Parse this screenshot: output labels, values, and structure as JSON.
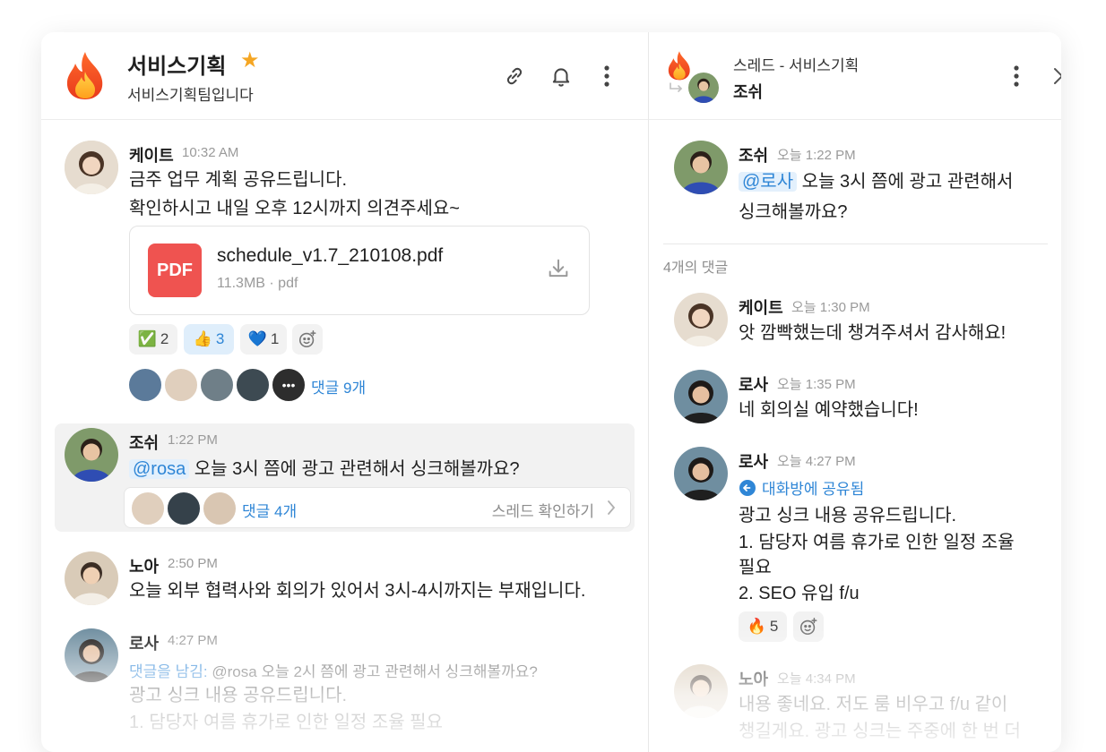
{
  "channel": {
    "title": "서비스기획",
    "subtitle": "서비스기획팀입니다",
    "icons": [
      "fire-emoji",
      "star-icon",
      "link-icon",
      "bell-icon",
      "more-vertical-icon"
    ]
  },
  "messages": [
    {
      "name": "케이트",
      "time": "10:32 AM",
      "lines": [
        "금주 업무 계획 공유드립니다.",
        "확인하시고 내일 오후 12시까지 의견주세요~"
      ],
      "file": {
        "name": "schedule_v1.7_210108.pdf",
        "meta": "11.3MB · pdf",
        "badge": "PDF"
      },
      "reactions": [
        {
          "emoji": "✅",
          "count": "2"
        },
        {
          "emoji": "👍",
          "count": "3"
        },
        {
          "emoji": "💙",
          "count": "1"
        }
      ],
      "replies": "댓글 9개"
    },
    {
      "name": "조쉬",
      "time": "1:22 PM",
      "mention": "@rosa",
      "text": "오늘 3시 쯤에 광고 관련해서 싱크해볼까요?",
      "replies": "댓글 4개",
      "thread_link": "스레드 확인하기"
    },
    {
      "name": "노아",
      "time": "2:50 PM",
      "text": "오늘 외부 협력사와 회의가 있어서 3시-4시까지는 부재입니다."
    },
    {
      "name": "로사",
      "time": "4:27 PM",
      "reply_prefix": "댓글을 남김:",
      "reply_quote": "@rosa 오늘 2시 쯤에 광고 관련해서 싱크해볼까요?",
      "lines": [
        "광고 싱크 내용 공유드립니다.",
        "1. 담당자 여름 휴가로 인한 일정 조율 필요"
      ]
    }
  ],
  "thread": {
    "title": "스레드 - 서비스기획",
    "user": "조쉬",
    "root": {
      "name": "조쉬",
      "time": "오늘 1:22 PM",
      "mention": "@로사",
      "line1": "오늘 3시 쯤에 광고 관련해서",
      "line2": "싱크해볼까요?"
    },
    "count_label": "4개의 댓글",
    "replies": [
      {
        "name": "케이트",
        "time": "오늘 1:30 PM",
        "text": "앗 깜빡했는데 챙겨주셔서 감사해요!"
      },
      {
        "name": "로사",
        "time": "오늘 1:35 PM",
        "text": "네 회의실 예약했습니다!"
      },
      {
        "name": "로사",
        "time": "오늘 4:27 PM",
        "shared_label": "대화방에 공유됨",
        "lines": [
          "광고 싱크 내용 공유드립니다.",
          "1. 담당자 여름 휴가로 인한 일정 조율",
          "필요",
          "2. SEO 유입 f/u"
        ],
        "reaction": {
          "emoji": "🔥",
          "count": "5"
        }
      },
      {
        "name": "노아",
        "time": "오늘 4:34 PM",
        "lines": [
          "내용 좋네요. 저도 룸 비우고 f/u 같이",
          "챙길게요. 광고 싱크는 주중에 한 번 더"
        ]
      }
    ]
  },
  "colors": {
    "accent": "#2f86d6",
    "pdf": "#ef5350",
    "star": "#f5a623",
    "highlight": "#f2f2f2"
  }
}
